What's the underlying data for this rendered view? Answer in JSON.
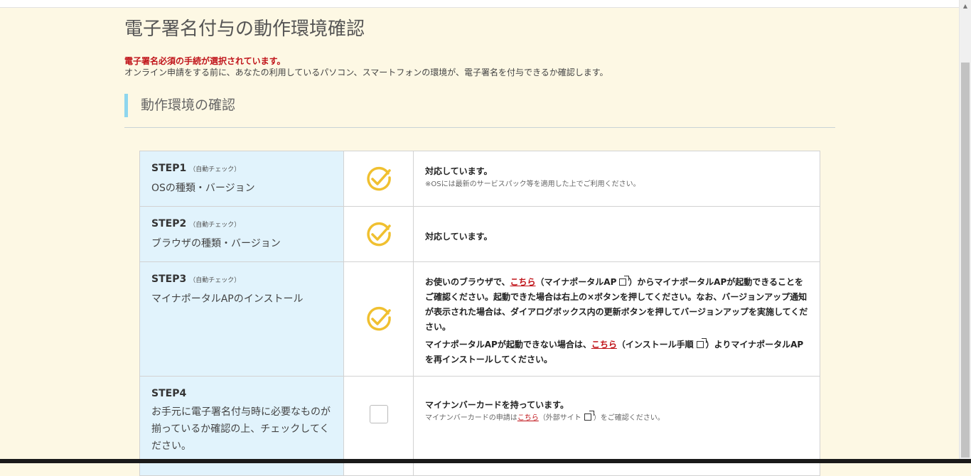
{
  "page": {
    "title": "電子署名付与の動作環境確認",
    "alert": "電子署名必須の手続が選択されています。",
    "description": "オンライン申請をする前に、あなたの利用しているパソコン、スマートフォンの環境が、電子署名を付与できるか確認します。",
    "section_heading": "動作環境の確認"
  },
  "steps": [
    {
      "title": "STEP1",
      "auto": "（自動チェック）",
      "subtitle": "OSの種類・バージョン",
      "status": "check-icon",
      "line1": "対応しています。",
      "note": "※OSには最新のサービスパック等を適用した上でご利用ください。"
    },
    {
      "title": "STEP2",
      "auto": "（自動チェック）",
      "subtitle": "ブラウザの種類・バージョン",
      "status": "check-icon",
      "line1": "対応しています。"
    },
    {
      "title": "STEP3",
      "auto": "（自動チェック）",
      "subtitle": "マイナポータルAPのインストール",
      "status": "check-icon",
      "p1_pre": "お使いのブラウザで、",
      "p1_link": "こちら",
      "p1_mid": "（マイナポータルAP",
      "p1_post": "）からマイナポータルAPが起動できることをご確認ください。起動できた場合は右上の×ボタンを押してください。なお、バージョンアップ通知が表示された場合は、ダイアログボックス内の更新ボタンを押してバージョンアップを実施してください。",
      "p2_pre": "マイナポータルAPが起動できない場合は、",
      "p2_link": "こちら",
      "p2_mid": "（インストール手順",
      "p2_post": "）よりマイナポータルAPを再インストールしてください。"
    },
    {
      "title": "STEP4",
      "subtitle": "お手元に電子署名付与時に必要なものが揃っているか確認の上、チェックしてください。",
      "status": "checkbox",
      "line1": "マイナンバーカードを持っています。",
      "note_pre": "マイナンバーカードの申請は",
      "note_link": "こちら",
      "note_mid": "（外部サイト",
      "note_post": "）をご確認ください。"
    }
  ],
  "colors": {
    "background": "#fdf8e4",
    "alert": "#c0141a",
    "step_label_bg": "#e1f3fc",
    "check": "#f0c030",
    "heading_bar": "#8ed6ee"
  }
}
